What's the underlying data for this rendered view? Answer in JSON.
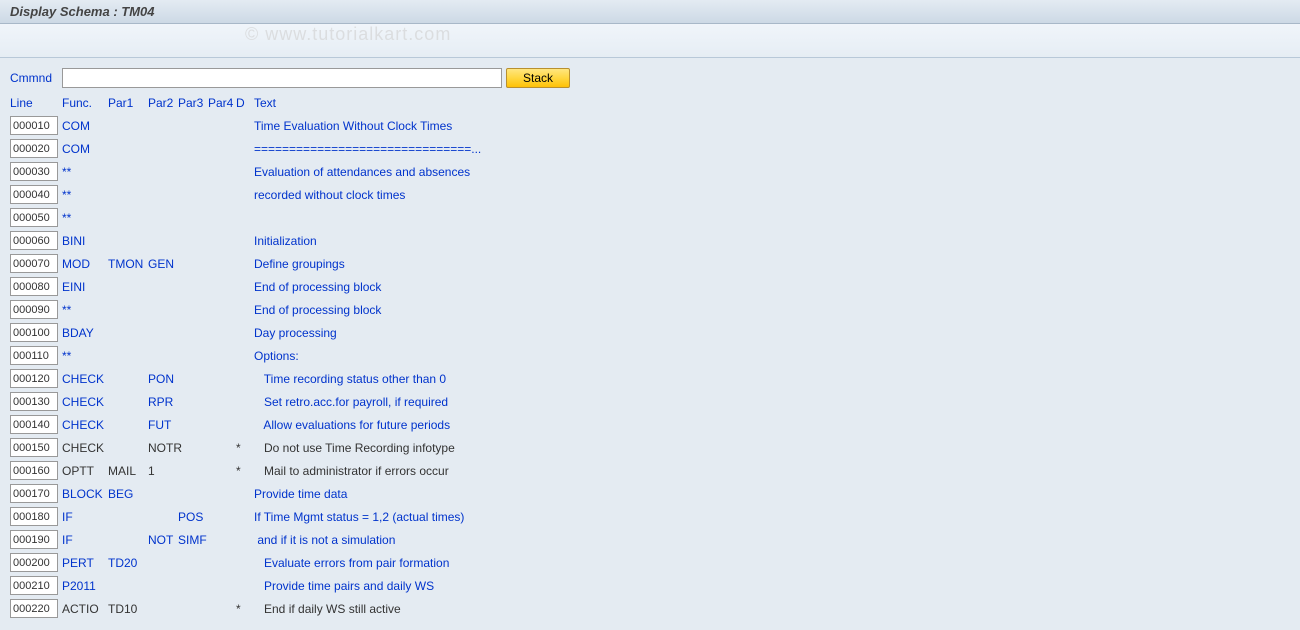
{
  "title": "Display Schema : TM04",
  "watermark": "© www.tutorialkart.com",
  "cmd": {
    "label": "Cmmnd",
    "value": "",
    "stack_label": "Stack"
  },
  "headers": {
    "line": "Line",
    "func": "Func.",
    "par1": "Par1",
    "par2": "Par2",
    "par3": "Par3",
    "par4": "Par4",
    "d": "D",
    "text": "Text"
  },
  "rows": [
    {
      "line": "000010",
      "func": "COM",
      "par1": "",
      "par2": "",
      "par3": "",
      "par4": "",
      "d": "",
      "text": "Time Evaluation Without Clock Times",
      "muted": false
    },
    {
      "line": "000020",
      "func": "COM",
      "par1": "",
      "par2": "",
      "par3": "",
      "par4": "",
      "d": "",
      "text": "===============================...",
      "muted": false
    },
    {
      "line": "000030",
      "func": "**",
      "par1": "",
      "par2": "",
      "par3": "",
      "par4": "",
      "d": "",
      "text": "Evaluation of attendances and absences",
      "muted": false
    },
    {
      "line": "000040",
      "func": "**",
      "par1": "",
      "par2": "",
      "par3": "",
      "par4": "",
      "d": "",
      "text": "recorded without clock times",
      "muted": false
    },
    {
      "line": "000050",
      "func": "**",
      "par1": "",
      "par2": "",
      "par3": "",
      "par4": "",
      "d": "",
      "text": "",
      "muted": false
    },
    {
      "line": "000060",
      "func": "BINI",
      "par1": "",
      "par2": "",
      "par3": "",
      "par4": "",
      "d": "",
      "text": "Initialization",
      "muted": false
    },
    {
      "line": "000070",
      "func": "MOD",
      "par1": "TMON",
      "par2": "GEN",
      "par3": "",
      "par4": "",
      "d": "",
      "text": "Define groupings",
      "muted": false
    },
    {
      "line": "000080",
      "func": "EINI",
      "par1": "",
      "par2": "",
      "par3": "",
      "par4": "",
      "d": "",
      "text": "End of processing block",
      "muted": false
    },
    {
      "line": "000090",
      "func": "**",
      "par1": "",
      "par2": "",
      "par3": "",
      "par4": "",
      "d": "",
      "text": "End of processing block",
      "muted": false
    },
    {
      "line": "000100",
      "func": "BDAY",
      "par1": "",
      "par2": "",
      "par3": "",
      "par4": "",
      "d": "",
      "text": "Day processing",
      "muted": false
    },
    {
      "line": "000110",
      "func": "**",
      "par1": "",
      "par2": "",
      "par3": "",
      "par4": "",
      "d": "",
      "text": "Options:",
      "muted": false
    },
    {
      "line": "000120",
      "func": "CHECK",
      "par1": "",
      "par2": "PON",
      "par3": "",
      "par4": "",
      "d": "",
      "text": "   Time recording status other than 0",
      "muted": false
    },
    {
      "line": "000130",
      "func": "CHECK",
      "par1": "",
      "par2": "RPR",
      "par3": "",
      "par4": "",
      "d": "",
      "text": "   Set retro.acc.for payroll, if required",
      "muted": false
    },
    {
      "line": "000140",
      "func": "CHECK",
      "par1": "",
      "par2": "FUT",
      "par3": "",
      "par4": "",
      "d": "",
      "text": "   Allow evaluations for future periods",
      "muted": false
    },
    {
      "line": "000150",
      "func": "CHECK",
      "par1": "",
      "par2": "NOTR",
      "par3": "",
      "par4": "",
      "d": "*",
      "text": "   Do not use Time Recording infotype",
      "muted": true
    },
    {
      "line": "000160",
      "func": "OPTT",
      "par1": "MAIL",
      "par2": "1",
      "par3": "",
      "par4": "",
      "d": "*",
      "text": "   Mail to administrator if errors occur",
      "muted": true
    },
    {
      "line": "000170",
      "func": "BLOCK",
      "par1": "BEG",
      "par2": "",
      "par3": "",
      "par4": "",
      "d": "",
      "text": "Provide time data",
      "muted": false
    },
    {
      "line": "000180",
      "func": "IF",
      "par1": "",
      "par2": "",
      "par3": "POS",
      "par4": "",
      "d": "",
      "text": "If Time Mgmt status = 1,2 (actual times)",
      "muted": false
    },
    {
      "line": "000190",
      "func": "IF",
      "par1": "",
      "par2": "NOT",
      "par3": "SIMF",
      "par4": "",
      "d": "",
      "text": " and if it is not a simulation",
      "muted": false
    },
    {
      "line": "000200",
      "func": "PERT",
      "par1": "TD20",
      "par2": "",
      "par3": "",
      "par4": "",
      "d": "",
      "text": "   Evaluate errors from pair formation",
      "muted": false
    },
    {
      "line": "000210",
      "func": "P2011",
      "par1": "",
      "par2": "",
      "par3": "",
      "par4": "",
      "d": "",
      "text": "   Provide time pairs and daily WS",
      "muted": false
    },
    {
      "line": "000220",
      "func": "ACTIO",
      "par1": "TD10",
      "par2": "",
      "par3": "",
      "par4": "",
      "d": "*",
      "text": "   End if daily WS still active",
      "muted": true
    }
  ]
}
